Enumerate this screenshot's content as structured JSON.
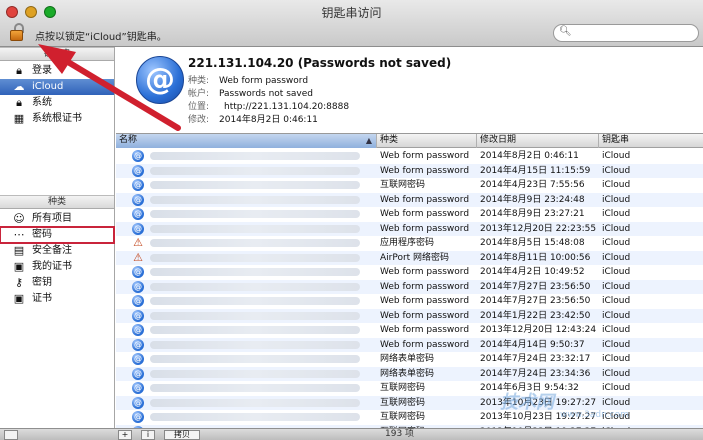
{
  "window": {
    "title": "钥匙串访问"
  },
  "toolbar": {
    "lock_hint": "点按以锁定“iCloud”钥匙串。",
    "search_placeholder": ""
  },
  "sidebar": {
    "keychains_header": "钥匙串",
    "keychains": [
      {
        "label": "登录",
        "icon": "lock-icon"
      },
      {
        "label": "iCloud",
        "icon": "cloud-icon",
        "selected": true
      },
      {
        "label": "系统",
        "icon": "lock-icon"
      },
      {
        "label": "系统根证书",
        "icon": "cabinet-icon"
      }
    ],
    "kinds_header": "种类",
    "kinds": [
      {
        "label": "所有项目",
        "icon": "people-icon"
      },
      {
        "label": "密码",
        "icon": "dots-icon"
      },
      {
        "label": "安全备注",
        "icon": "note-icon"
      },
      {
        "label": "我的证书",
        "icon": "certificate-icon"
      },
      {
        "label": "密钥",
        "icon": "key-icon"
      },
      {
        "label": "证书",
        "icon": "certificate-icon"
      }
    ]
  },
  "detail": {
    "title": "221.131.104.20 (Passwords not saved)",
    "kind_label": "种类:",
    "kind": "Web form password",
    "account_label": "帐户:",
    "account": "Passwords not saved",
    "where_label": "位置:",
    "where": "http://221.131.104.20:8888",
    "modified_label": "修改:",
    "modified": "2014年8月2日 0:46:11"
  },
  "table": {
    "headers": {
      "name": "名称",
      "kind": "种类",
      "date": "修改日期",
      "keychain": "钥匙串"
    },
    "rows": [
      {
        "icon": "at",
        "kind": "Web form password",
        "date": "2014年8月2日 0:46:11",
        "keychain": "iCloud"
      },
      {
        "icon": "at",
        "kind": "Web form password",
        "date": "2014年4月15日 11:15:59",
        "keychain": "iCloud"
      },
      {
        "icon": "at",
        "kind": "互联网密码",
        "date": "2014年4月23日 7:55:56",
        "keychain": "iCloud"
      },
      {
        "icon": "at",
        "kind": "Web form password",
        "date": "2014年8月9日 23:24:48",
        "keychain": "iCloud"
      },
      {
        "icon": "at",
        "kind": "Web form password",
        "date": "2014年8月9日 23:27:21",
        "keychain": "iCloud"
      },
      {
        "icon": "at",
        "kind": "Web form password",
        "date": "2013年12月20日 22:23:55",
        "keychain": "iCloud"
      },
      {
        "icon": "app",
        "kind": "应用程序密码",
        "date": "2014年8月5日 15:48:08",
        "keychain": "iCloud"
      },
      {
        "icon": "app",
        "kind": "AirPort 网络密码",
        "date": "2014年8月11日 10:00:56",
        "keychain": "iCloud"
      },
      {
        "icon": "at",
        "kind": "Web form password",
        "date": "2014年4月2日 10:49:52",
        "keychain": "iCloud"
      },
      {
        "icon": "at",
        "kind": "Web form password",
        "date": "2014年7月27日 23:56:50",
        "keychain": "iCloud"
      },
      {
        "icon": "at",
        "kind": "Web form password",
        "date": "2014年7月27日 23:56:50",
        "keychain": "iCloud"
      },
      {
        "icon": "at",
        "kind": "Web form password",
        "date": "2014年1月22日 23:42:50",
        "keychain": "iCloud"
      },
      {
        "icon": "at",
        "kind": "Web form password",
        "date": "2013年12月20日 12:43:24",
        "keychain": "iCloud"
      },
      {
        "icon": "at",
        "kind": "Web form password",
        "date": "2014年4月14日 9:50:37",
        "keychain": "iCloud"
      },
      {
        "icon": "at",
        "kind": "网络表单密码",
        "date": "2014年7月24日 23:32:17",
        "keychain": "iCloud"
      },
      {
        "icon": "at",
        "kind": "网络表单密码",
        "date": "2014年7月24日 23:34:36",
        "keychain": "iCloud"
      },
      {
        "icon": "at",
        "kind": "互联网密码",
        "date": "2014年6月3日 9:54:32",
        "keychain": "iCloud"
      },
      {
        "icon": "at",
        "kind": "互联网密码",
        "date": "2013年10月23日 19:27:27",
        "keychain": "iCloud"
      },
      {
        "icon": "at",
        "kind": "互联网密码",
        "date": "2013年10月23日 19:27:27",
        "keychain": "iCloud"
      },
      {
        "icon": "at",
        "kind": "互联网密码",
        "date": "2013年10月23日 19:27:27",
        "keychain": "iCloud"
      }
    ]
  },
  "bottombar": {
    "add": "+",
    "info": "i",
    "copy": "拷贝",
    "count": "193 项"
  },
  "watermark": {
    "main": "技术网",
    "sub": "www.3adn.com"
  },
  "colors": {
    "selection": "#2f62b9",
    "annotation": "#d0202e"
  }
}
